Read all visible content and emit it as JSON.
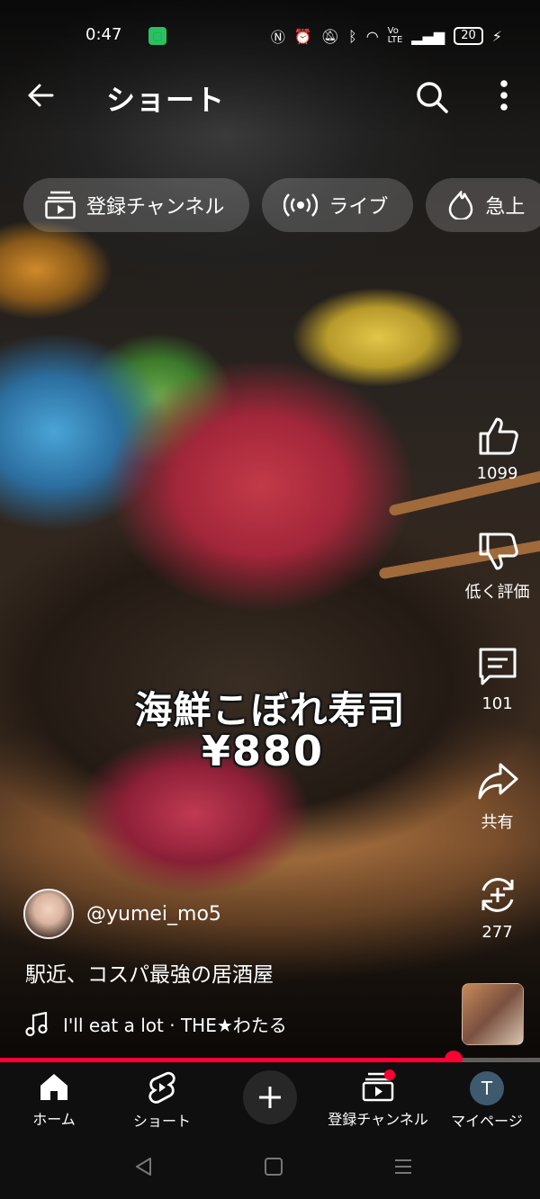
{
  "status_bar": {
    "time": "0:47",
    "battery": "20"
  },
  "header": {
    "title": "ショート"
  },
  "chips": [
    {
      "label": "登録チャンネル",
      "icon": "subscriptions-icon"
    },
    {
      "label": "ライブ",
      "icon": "live-icon"
    },
    {
      "label": "急上",
      "icon": "trending-icon"
    }
  ],
  "video": {
    "caption_line1": "海鮮こぼれ寿司",
    "caption_line2": "¥880",
    "channel_handle": "@yumei_mo5",
    "description": "駅近、コスパ最強の居酒屋",
    "music": "I'll eat a lot · THE★わたる",
    "progress_percent": 84
  },
  "actions": {
    "like_count": "1099",
    "dislike_label": "低く評価",
    "comment_count": "101",
    "share_label": "共有",
    "remix_count": "277"
  },
  "bottom_nav": {
    "home": "ホーム",
    "shorts": "ショート",
    "subscriptions": "登録チャンネル",
    "mypage": "マイページ",
    "avatar_letter": "T"
  },
  "colors": {
    "accent": "#ff0033",
    "background": "#0f0f0f"
  }
}
